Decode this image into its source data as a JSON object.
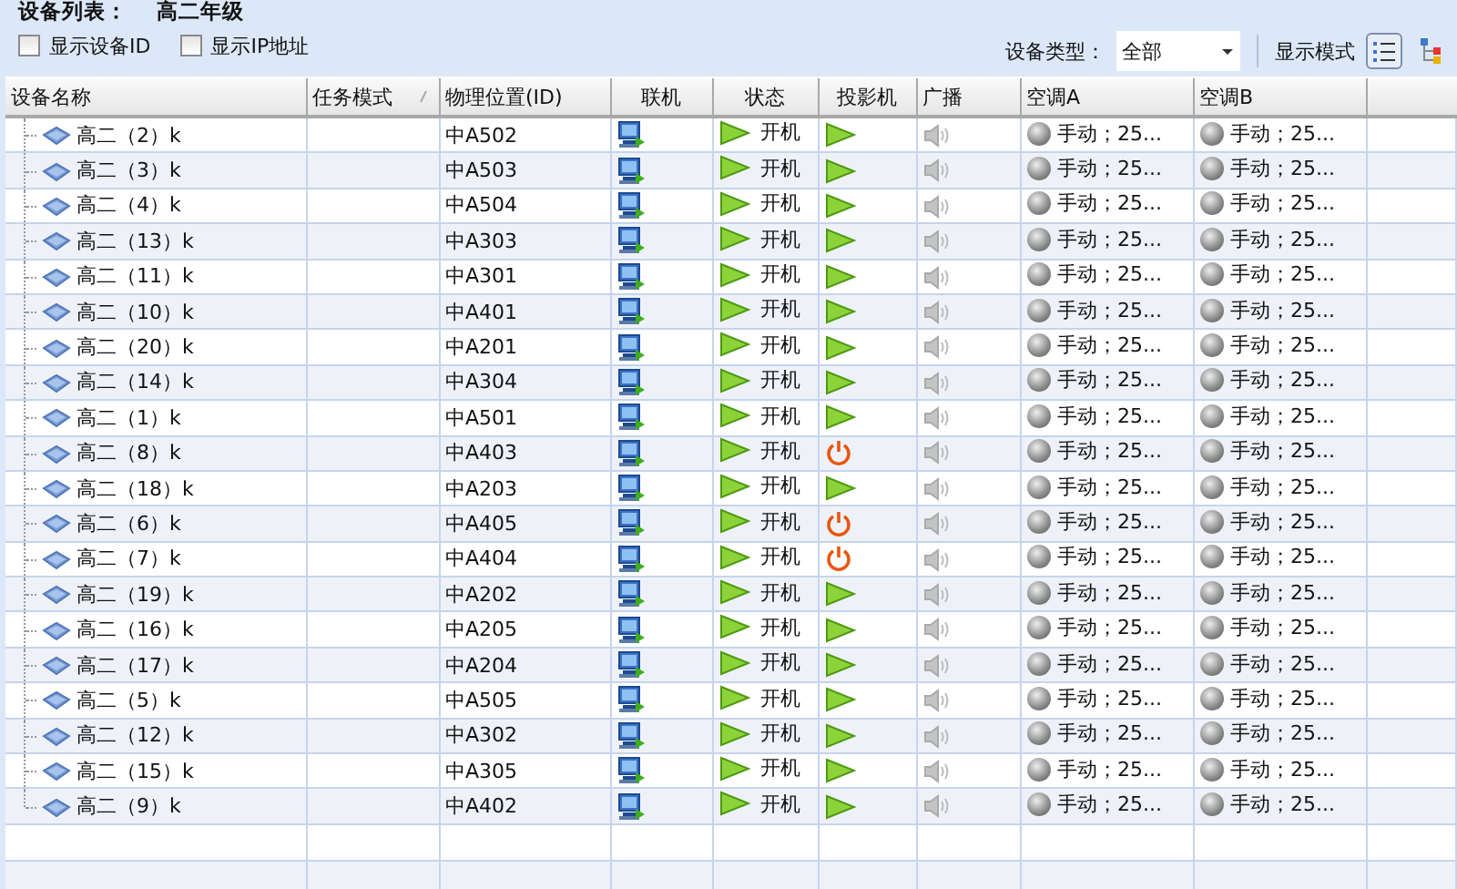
{
  "header": {
    "label": "设备列表：",
    "value": "高二年级"
  },
  "options": [
    {
      "label": "显示设备ID",
      "checked": false
    },
    {
      "label": "显示IP地址",
      "checked": false
    }
  ],
  "toolbar": {
    "type_label": "设备类型：",
    "type_value": "全部",
    "mode_label": "显示模式",
    "modes": [
      {
        "kind": "list",
        "selected": true
      },
      {
        "kind": "tree",
        "selected": false
      }
    ]
  },
  "table": {
    "columns": [
      "设备名称",
      "任务模式",
      "物理位置(ID)",
      "联机",
      "状态",
      "投影机",
      "广播",
      "空调A",
      "空调B"
    ],
    "rows": [
      {
        "name": "高二（2）k",
        "location": "中A502",
        "status": "开机",
        "projector_on": true,
        "ac_a": "手动；25...",
        "ac_b": "手动；25..."
      },
      {
        "name": "高二（3）k",
        "location": "中A503",
        "status": "开机",
        "projector_on": true,
        "ac_a": "手动；25...",
        "ac_b": "手动；25..."
      },
      {
        "name": "高二（4）k",
        "location": "中A504",
        "status": "开机",
        "projector_on": true,
        "ac_a": "手动；25...",
        "ac_b": "手动；25..."
      },
      {
        "name": "高二（13）k",
        "location": "中A303",
        "status": "开机",
        "projector_on": true,
        "ac_a": "手动；25...",
        "ac_b": "手动；25..."
      },
      {
        "name": "高二（11）k",
        "location": "中A301",
        "status": "开机",
        "projector_on": true,
        "ac_a": "手动；25...",
        "ac_b": "手动；25..."
      },
      {
        "name": "高二（10）k",
        "location": "中A401",
        "status": "开机",
        "projector_on": true,
        "ac_a": "手动；25...",
        "ac_b": "手动；25..."
      },
      {
        "name": "高二（20）k",
        "location": "中A201",
        "status": "开机",
        "projector_on": true,
        "ac_a": "手动；25...",
        "ac_b": "手动；25..."
      },
      {
        "name": "高二（14）k",
        "location": "中A304",
        "status": "开机",
        "projector_on": true,
        "ac_a": "手动；25...",
        "ac_b": "手动；25..."
      },
      {
        "name": "高二（1）k",
        "location": "中A501",
        "status": "开机",
        "projector_on": true,
        "ac_a": "手动；25...",
        "ac_b": "手动；25..."
      },
      {
        "name": "高二（8）k",
        "location": "中A403",
        "status": "开机",
        "projector_on": false,
        "ac_a": "手动；25...",
        "ac_b": "手动；25..."
      },
      {
        "name": "高二（18）k",
        "location": "中A203",
        "status": "开机",
        "projector_on": true,
        "ac_a": "手动；25...",
        "ac_b": "手动；25..."
      },
      {
        "name": "高二（6）k",
        "location": "中A405",
        "status": "开机",
        "projector_on": false,
        "ac_a": "手动；25...",
        "ac_b": "手动；25..."
      },
      {
        "name": "高二（7）k",
        "location": "中A404",
        "status": "开机",
        "projector_on": false,
        "ac_a": "手动；25...",
        "ac_b": "手动；25..."
      },
      {
        "name": "高二（19）k",
        "location": "中A202",
        "status": "开机",
        "projector_on": true,
        "ac_a": "手动；25...",
        "ac_b": "手动；25..."
      },
      {
        "name": "高二（16）k",
        "location": "中A205",
        "status": "开机",
        "projector_on": true,
        "ac_a": "手动；25...",
        "ac_b": "手动；25..."
      },
      {
        "name": "高二（17）k",
        "location": "中A204",
        "status": "开机",
        "projector_on": true,
        "ac_a": "手动；25...",
        "ac_b": "手动；25..."
      },
      {
        "name": "高二（5）k",
        "location": "中A505",
        "status": "开机",
        "projector_on": true,
        "ac_a": "手动；25...",
        "ac_b": "手动；25..."
      },
      {
        "name": "高二（12）k",
        "location": "中A302",
        "status": "开机",
        "projector_on": true,
        "ac_a": "手动；25...",
        "ac_b": "手动；25..."
      },
      {
        "name": "高二（15）k",
        "location": "中A305",
        "status": "开机",
        "projector_on": true,
        "ac_a": "手动；25...",
        "ac_b": "手动；25..."
      },
      {
        "name": "高二（9）k",
        "location": "中A402",
        "status": "开机",
        "projector_on": true,
        "ac_a": "手动；25...",
        "ac_b": "手动；25..."
      }
    ]
  }
}
